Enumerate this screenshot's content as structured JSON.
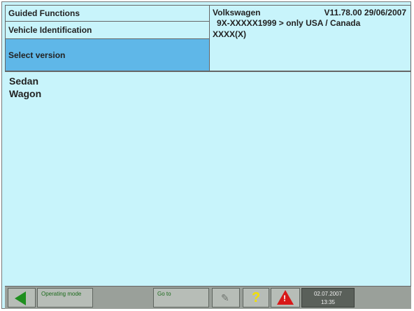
{
  "header": {
    "rows": [
      "Guided Functions",
      "Vehicle Identification",
      "Select version"
    ],
    "make": "Volkswagen",
    "version": "V11.78.00 29/06/2007",
    "model": "9X-XXXXX1999 > only USA / Canada",
    "engine": "XXXX(X)"
  },
  "versions": [
    "Sedan",
    "Wagon"
  ],
  "toolbar": {
    "operating_label": "Operating mode",
    "goto_label": "Go to",
    "tool_icon": "wrench-icon",
    "help_label": "?",
    "warning_label": "!",
    "date": "02.07.2007",
    "time": "13:35"
  },
  "colors": {
    "background": "#c8f4fb",
    "selected_row": "#5fb7e8",
    "toolbar": "#9aa09a",
    "back_arrow": "#1f8f1f",
    "help": "#f2e000",
    "warning": "#d81818"
  }
}
